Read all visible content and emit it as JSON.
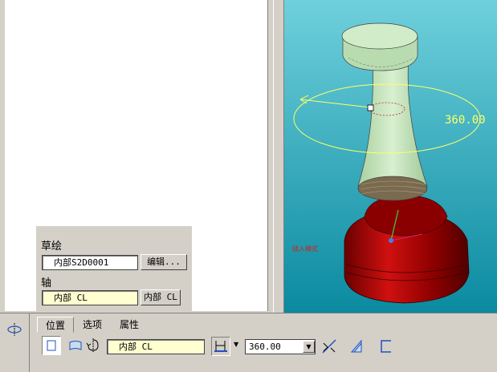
{
  "viewport": {
    "angle_readout": "360.00",
    "mode_label": "插入模式"
  },
  "panel": {
    "sketch_label": "草绘",
    "sketch_value": "内部S2D0001",
    "edit_button": "编辑...",
    "axis_label": "轴",
    "axis_value": "内部 CL",
    "axis_button": "内部 CL"
  },
  "dashboard": {
    "tabs": [
      "位置",
      "选项",
      "属性"
    ],
    "axis_field": "内部 CL",
    "angle_value": "360.00"
  },
  "colors": {
    "viewport_top": "#5fc8d8",
    "viewport_bottom": "#0c8aa0",
    "model_green": "#c8e6c0",
    "base_red": "#a00000",
    "preview_yellow": "#ffff66"
  },
  "icons": {
    "revolve": "revolve-feature-icon",
    "solid": "solid-icon",
    "surface": "surface-icon",
    "flip": "flip-direction-icon",
    "depth": "depth-option-icon",
    "remove_material": "remove-material-icon",
    "thicken": "thicken-sketch-icon",
    "bracket": "bracket-icon"
  }
}
